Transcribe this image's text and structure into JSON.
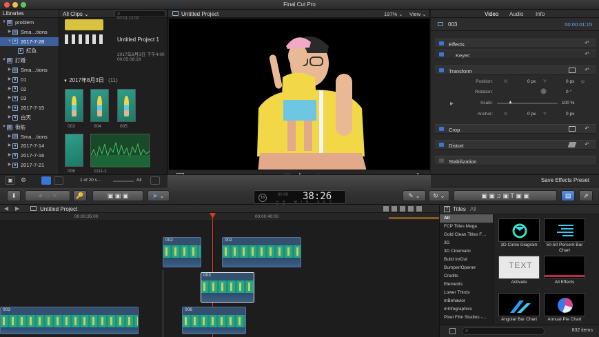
{
  "app": {
    "title": "Final Cut Pro"
  },
  "libraries": {
    "header": "Libraries",
    "items": [
      {
        "label": "problem",
        "level": 0,
        "kind": "library"
      },
      {
        "label": "Sma…tions",
        "level": 1,
        "kind": "folder"
      },
      {
        "label": "2017-7-28",
        "level": 1,
        "kind": "event",
        "selected": true
      },
      {
        "label": "紅色",
        "level": 2,
        "kind": "keyword"
      },
      {
        "label": "訂婚",
        "level": 0,
        "kind": "library"
      },
      {
        "label": "Sma…tions",
        "level": 1,
        "kind": "folder"
      },
      {
        "label": "01",
        "level": 1,
        "kind": "event"
      },
      {
        "label": "02",
        "level": 1,
        "kind": "event"
      },
      {
        "label": "03",
        "level": 1,
        "kind": "event"
      },
      {
        "label": "2017-7-15",
        "level": 1,
        "kind": "event"
      },
      {
        "label": "白天",
        "level": 1,
        "kind": "event"
      },
      {
        "label": "街舫",
        "level": 0,
        "kind": "library"
      },
      {
        "label": "Sma…tions",
        "level": 1,
        "kind": "folder"
      },
      {
        "label": "2017-7-14",
        "level": 1,
        "kind": "event"
      },
      {
        "label": "2017-7-16",
        "level": 1,
        "kind": "event"
      },
      {
        "label": "2017-7-21",
        "level": 1,
        "kind": "event"
      }
    ]
  },
  "browser": {
    "filter": "All Clips",
    "project_name": "Untitled Project 1",
    "project_date": "2017年8月3日 下午4:00",
    "project_duration": "00:05:08:19",
    "top_timecode": "00:01:13:00",
    "date_group": "2017年8月3日",
    "date_count": "(11)",
    "clips": [
      "003",
      "004",
      "005",
      "006",
      "1111-1"
    ],
    "selection_count": "1 of 20 s…",
    "footer_filter": "All"
  },
  "viewer": {
    "title": "Untitled Project",
    "zoom": "197%",
    "view_menu": "View"
  },
  "inspector": {
    "tabs": [
      "Video",
      "Audio",
      "Info"
    ],
    "active_tab": "Video",
    "clip_name": "003",
    "clip_timecode": "00:00:01:15",
    "sections": {
      "effects": "Effects",
      "keyer": "Keyer:",
      "transform": "Transform",
      "crop": "Crop",
      "distort": "Distort",
      "stabilization": "Stabilization"
    },
    "props": {
      "position": {
        "label": "Position:",
        "x_label": "X:",
        "x": "0",
        "x_unit": "px",
        "y_label": "Y:",
        "y": "0",
        "y_unit": "px"
      },
      "rotation": {
        "label": "Rotation:",
        "value": "0",
        "unit": "°"
      },
      "scale": {
        "label": "Scale:",
        "value": "100 %"
      },
      "anchor": {
        "label": "Anchor:",
        "x_label": "X:",
        "x": "0",
        "x_unit": "px",
        "y_label": "Y:",
        "y": "0",
        "y_unit": "px"
      }
    },
    "save_preset": "Save Effects Preset"
  },
  "toolbar": {
    "timecode_main": "38:26",
    "timecode_frames": "16",
    "timecode_sublabels": [
      "HR",
      "MIN",
      "SEC",
      "FR"
    ]
  },
  "timeline": {
    "title": "Untitled Project",
    "ruler_marks": [
      "00:00:35:00",
      "00:00:40:00"
    ],
    "clips": [
      {
        "name": "002"
      },
      {
        "name": "002"
      },
      {
        "name": "003"
      },
      {
        "name": "003"
      },
      {
        "name": "006"
      }
    ]
  },
  "effects_browser": {
    "header": "Titles",
    "header_filter": "All",
    "categories": [
      "All",
      "FCP Titles Mega",
      "Gold Clean Titles F…",
      "3D",
      "3D Cinematic",
      "Build In/Out",
      "Bumper/Opener",
      "Credits",
      "Elements",
      "Lower Thirds",
      "mBehavior",
      "mInfographics",
      "Pixel Film Studios -…"
    ],
    "selected_category": "All",
    "tiles": [
      "3D Circle Diagram",
      "50-50 Percent Bar Chart",
      "Activate",
      "All Effects",
      "Angular Bar Chart",
      "Annual Pie Chart"
    ],
    "activate_thumb_text": "TEXT",
    "item_count": "832 items"
  },
  "colors": {
    "accent": "#3a76d6",
    "selection": "#3d5f9a",
    "clip": "#34506f",
    "playhead": "#d23a2a"
  }
}
